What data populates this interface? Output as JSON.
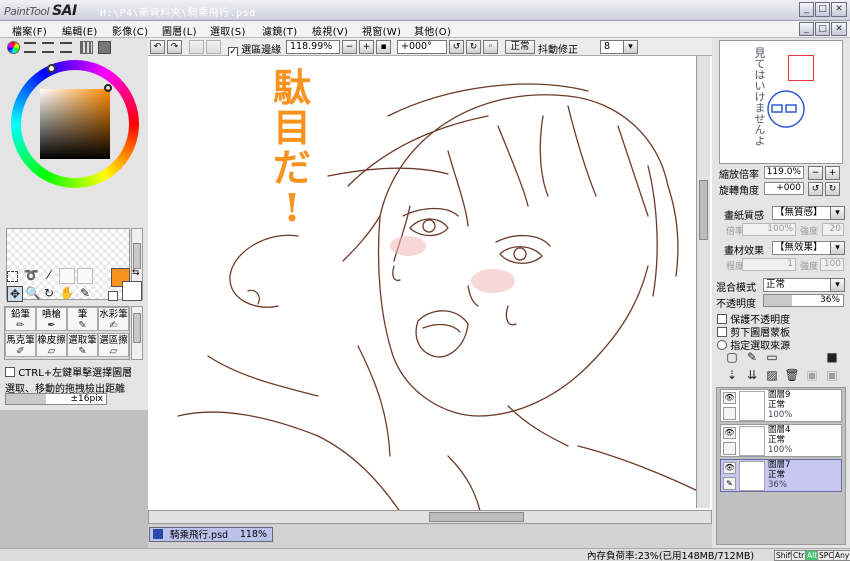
{
  "app": {
    "logo_small": "PaintTool",
    "logo_big": "SAI",
    "window_title": "H:\\P4\\新資料夾\\騎乘飛行.psd"
  },
  "menu": [
    {
      "label": "檔案(F)"
    },
    {
      "label": "編輯(E)"
    },
    {
      "label": "影像(C)"
    },
    {
      "label": "圖層(L)"
    },
    {
      "label": "選取(S)"
    },
    {
      "label": "濾鏡(T)"
    },
    {
      "label": "檢視(V)"
    },
    {
      "label": "視窗(W)"
    },
    {
      "label": "其他(O)"
    }
  ],
  "toolbar": {
    "selection_edge_label": "選區邊緣",
    "selection_edge_checked": true,
    "zoom_value": "118.99%",
    "rotation_value": "+000°",
    "blend_value": "正常",
    "stabilizer_label": "抖動修正",
    "stabilizer_value": "8"
  },
  "color": {
    "current": "#f7931e",
    "secondary": "#ffffff"
  },
  "brushes": [
    {
      "label": "鉛筆",
      "icon": "pencil-icon"
    },
    {
      "label": "噴槍",
      "icon": "airbrush-icon"
    },
    {
      "label": "筆",
      "icon": "pen-icon"
    },
    {
      "label": "水彩筆",
      "icon": "watercolor-icon"
    },
    {
      "label": "馬克筆",
      "icon": "marker-icon"
    },
    {
      "label": "橡皮擦",
      "icon": "eraser-icon"
    },
    {
      "label": "選取筆",
      "icon": "select-pen-icon"
    },
    {
      "label": "選區擦",
      "icon": "select-eraser-icon"
    }
  ],
  "left_options": {
    "ctrl_select_label": "CTRL+左鍵單擊選擇圖層",
    "ctrl_select_checked": false,
    "drag_distance_label": "選取、移動的拖拽檢出距離",
    "drag_distance_value": "±16pix"
  },
  "canvas": {
    "annotation_line1": "駄",
    "annotation_line2": "目",
    "annotation_line3": "だ",
    "annotation_line4": "!",
    "annotation_color": "#f7931e",
    "line_color": "#6b3b2a"
  },
  "navigator": {
    "thumb_text": "見てはいけませんよ",
    "zoom_label": "縮放倍率",
    "zoom_value": "119.0%",
    "angle_label": "旋轉角度",
    "angle_value": "+000"
  },
  "layer_props": {
    "paper_texture_label": "畫紙質感",
    "paper_texture_value": "【無質感】",
    "ratio_label": "倍率",
    "ratio_value": "100%",
    "strength_label": "強度",
    "strength_value": "20",
    "effect_label": "畫材效果",
    "effect_value": "【無效果】",
    "level_label": "程度",
    "level_value": "1",
    "strength2_label": "強度",
    "strength2_value": "100",
    "blend_mode_label": "混合模式",
    "blend_mode_value": "正常",
    "opacity_label": "不透明度",
    "opacity_value": "36%",
    "opacity_fraction": 0.36,
    "preserve_opacity_label": "保護不透明度",
    "clipping_label": "剪下圖層蒙板",
    "selection_source_label": "指定選取來源"
  },
  "layers": [
    {
      "name": "圖層9",
      "mode": "正常",
      "opacity": "100%",
      "selected": false
    },
    {
      "name": "圖層4",
      "mode": "正常",
      "opacity": "100%",
      "selected": false
    },
    {
      "name": "圖層7",
      "mode": "正常",
      "opacity": "36%",
      "selected": true
    }
  ],
  "document_tab": {
    "name": "騎乘飛行.psd",
    "zoom": "118%"
  },
  "status": {
    "memory": "內存負荷率:23%(已用148MB/712MB)",
    "indicators": [
      "Shift",
      "Ctrl",
      "Alt",
      "SPC",
      "Any"
    ]
  }
}
